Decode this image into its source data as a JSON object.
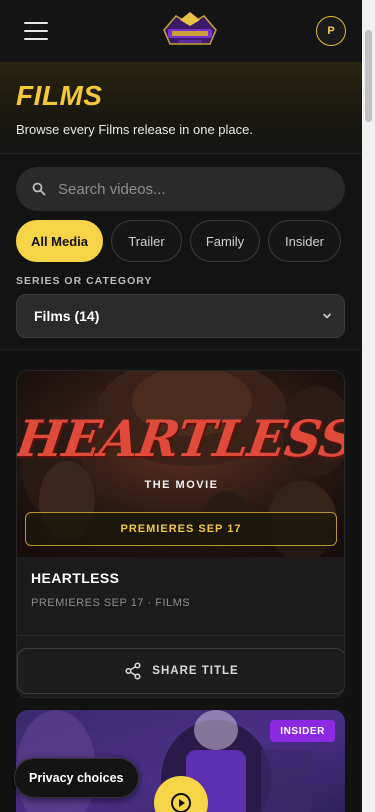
{
  "header": {
    "menu_icon": "hamburger-menu-icon",
    "logo_icon": "brand-crown-logo",
    "avatar_initial": "P"
  },
  "hero": {
    "title": "FILMS",
    "subtitle": "Browse every Films release in one place."
  },
  "search": {
    "placeholder": "Search videos...",
    "value": "",
    "icon": "search-icon"
  },
  "filters": {
    "chips": [
      {
        "label": "All Media",
        "active": true
      },
      {
        "label": "Trailer",
        "active": false
      },
      {
        "label": "Family",
        "active": false
      },
      {
        "label": "Insider",
        "active": false
      }
    ],
    "series_label": "SERIES OR CATEGORY",
    "series_selected": "Films (14)"
  },
  "cards": [
    {
      "poster_title": "HEARTLESS",
      "poster_subtitle": "THE MOVIE",
      "badge": "PREMIERES SEP 17",
      "title": "HEARTLESS",
      "meta": "PREMIERES SEP 17 · FILMS",
      "share_label": "SHARE TITLE",
      "share_icon": "share-icon"
    },
    {
      "tag": "INSIDER",
      "play_icon": "play-icon"
    }
  ],
  "privacy": {
    "label": "Privacy choices"
  },
  "colors": {
    "accent": "#f5d547",
    "title_gold": "#f5c83a",
    "insider_purple": "#8b2ae2",
    "background": "#111111"
  }
}
